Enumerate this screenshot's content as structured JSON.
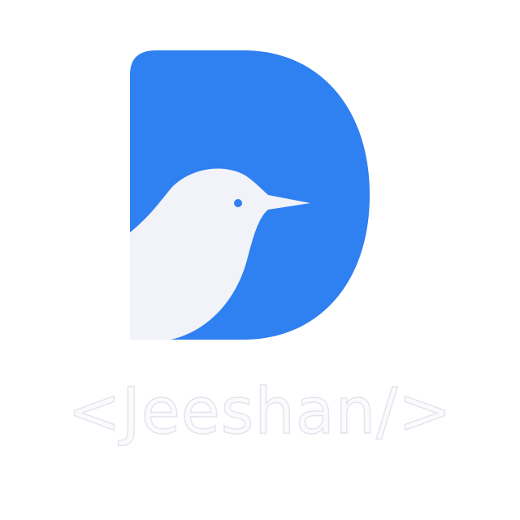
{
  "logo": {
    "icon": "d-letter-with-bird-icon",
    "wordmark": "<Jeeshan/>"
  },
  "colors": {
    "background": "#ffffff",
    "brand_blue": "#2f80f1",
    "bird_white": "#f2f3f8",
    "bird_eye": "#2f80f1",
    "wordmark_fill": "#fbfbfd",
    "wordmark_outline": "#e2e4ec"
  }
}
